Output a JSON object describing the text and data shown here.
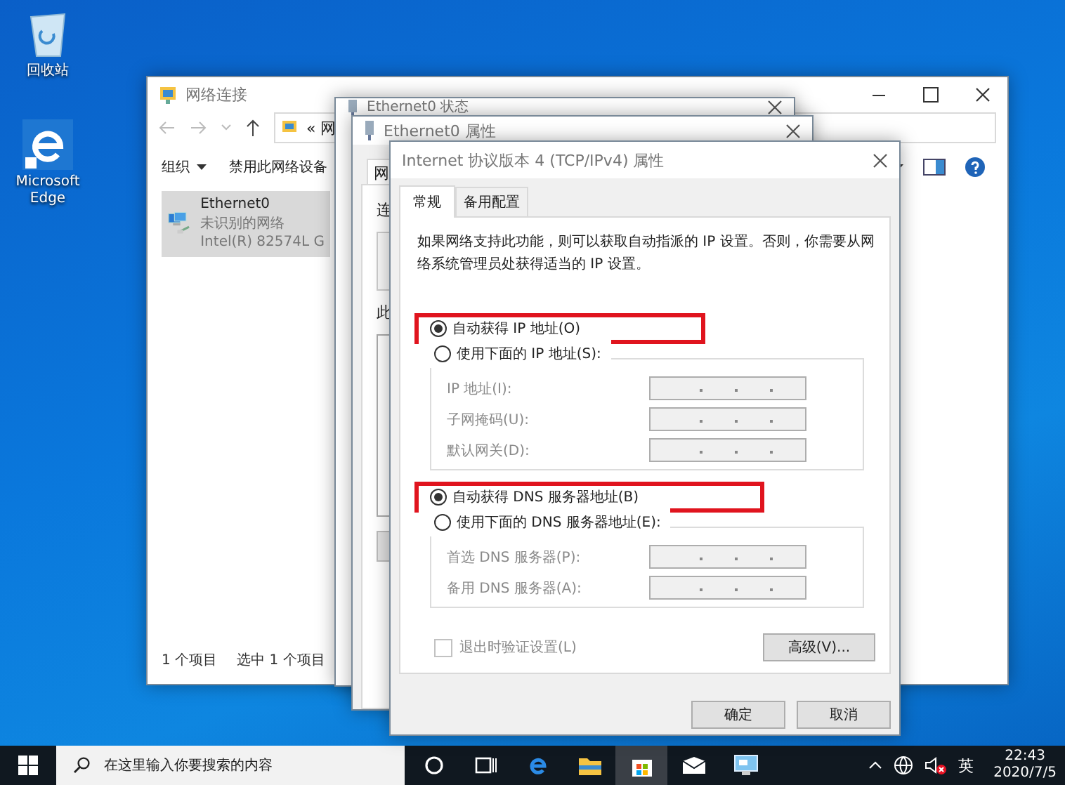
{
  "desktop_icons": [
    {
      "kind": "recycle-bin",
      "label": "回收站"
    },
    {
      "kind": "edge",
      "label": "Microsoft Edge"
    }
  ],
  "network_window": {
    "title": "网络连接",
    "address": "« 网",
    "toolbar": [
      {
        "label": "组织",
        "dropdown": true
      },
      {
        "label": "禁用此网络设备",
        "dropdown": false
      }
    ],
    "adapter": {
      "name": "Ethernet0",
      "status": "未识别的网络",
      "device": "Intel(R) 82574L G",
      "selected": true
    },
    "status_bar": [
      "1 个项目",
      "选中 1 个项目"
    ]
  },
  "status_window": {
    "title": "Ethernet0 状态"
  },
  "properties_window": {
    "title": "Ethernet0 属性",
    "tab": "网",
    "labels": [
      "连",
      "此"
    ]
  },
  "ipv4_dialog": {
    "title": "Internet 协议版本 4 (TCP/IPv4) 属性",
    "tabs": [
      {
        "label": "常规",
        "selected": true
      },
      {
        "label": "备用配置",
        "selected": false
      }
    ],
    "description": "如果网络支持此功能，则可以获取自动指派的 IP 设置。否则，你需要从网络系统管理员处获得适当的 IP 设置。",
    "ip_options": [
      {
        "label": "自动获得 IP 地址(O)",
        "selected": true,
        "highlighted": true
      },
      {
        "label": "使用下面的 IP 地址(S):",
        "selected": false,
        "highlighted": false
      }
    ],
    "ip_fields": [
      {
        "label": "IP 地址(I):",
        "disabled": true
      },
      {
        "label": "子网掩码(U):",
        "disabled": true
      },
      {
        "label": "默认网关(D):",
        "disabled": true
      }
    ],
    "dns_options": [
      {
        "label": "自动获得 DNS 服务器地址(B)",
        "selected": true,
        "highlighted": true
      },
      {
        "label": "使用下面的 DNS 服务器地址(E):",
        "selected": false,
        "highlighted": false
      }
    ],
    "dns_fields": [
      {
        "label": "首选 DNS 服务器(P):",
        "disabled": true
      },
      {
        "label": "备用 DNS 服务器(A):",
        "disabled": true
      }
    ],
    "validate": {
      "label": "退出时验证设置(L)",
      "checked": false,
      "disabled": true
    },
    "advanced_button": "高级(V)...",
    "buttons": [
      "确定",
      "取消"
    ]
  },
  "taskbar": {
    "search_placeholder": "在这里输入你要搜索的内容",
    "apps": [
      {
        "kind": "cortana",
        "selected": false
      },
      {
        "kind": "task-view",
        "selected": false
      },
      {
        "kind": "edge",
        "selected": false
      },
      {
        "kind": "explorer",
        "selected": false
      },
      {
        "kind": "store",
        "selected": true
      },
      {
        "kind": "mail",
        "selected": false
      },
      {
        "kind": "network-app",
        "selected": false
      }
    ],
    "language": "英",
    "time": "22:43",
    "date": "2020/7/5"
  }
}
